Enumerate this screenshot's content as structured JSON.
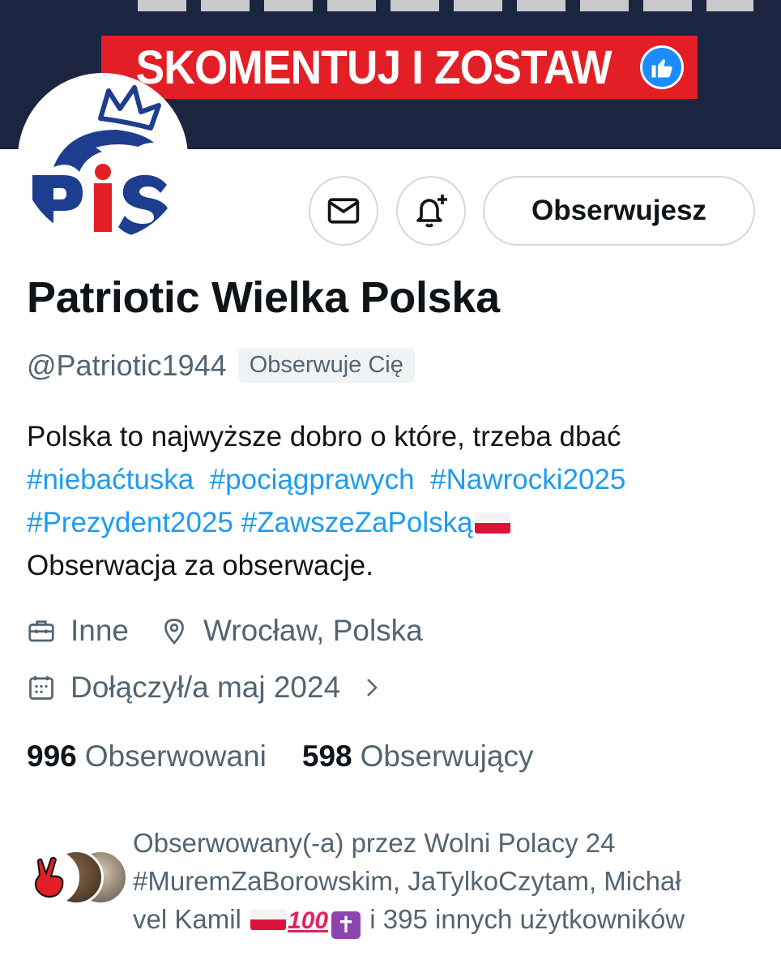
{
  "banner": {
    "cta_text": "SKOMENTUJ I ZOSTAW",
    "accent_color": "#e31e24",
    "background_color": "#1c2540",
    "badge_icon": "thumbs-up-icon"
  },
  "avatar": {
    "logo_text": "PiS",
    "icon": "crowned-eagle-logo"
  },
  "actions": {
    "message_icon": "envelope-icon",
    "notify_icon": "bell-plus-icon",
    "follow_label": "Obserwujesz"
  },
  "profile": {
    "display_name": "Patriotic Wielka Polska",
    "handle": "@Patriotic1944",
    "follows_you": "Obserwuje Cię",
    "bio_line1": "Polska to najwyższe dobro o które, trzeba dbać",
    "hashtags_line2": [
      "#niebaćtuska",
      "#pociągprawych",
      "#Nawrocki2025"
    ],
    "hashtags_line3": [
      "#Prezydent2025",
      "#ZawszeZaPolską"
    ],
    "bio_line4": "Obserwacja za obserwacje.",
    "category": "Inne",
    "location": "Wrocław, Polska",
    "joined": "Dołączył/a maj 2024"
  },
  "stats": {
    "following_count": "996",
    "following_label": "Obserwowani",
    "followers_count": "598",
    "followers_label": "Obserwujący"
  },
  "followed_by": {
    "line1": "Obserwowany(-a) przez Wolni Polacy 24",
    "line2": "#MuremZaBorowskim, JaTylkoCzytam, Michał",
    "line3_start": "vel Kamil",
    "line3_end": "i 395 innych użytkowników"
  },
  "colors": {
    "link": "#1d9bf0",
    "secondary_text": "#536471",
    "primary_text": "#0f1419",
    "border": "#cfd9de"
  }
}
